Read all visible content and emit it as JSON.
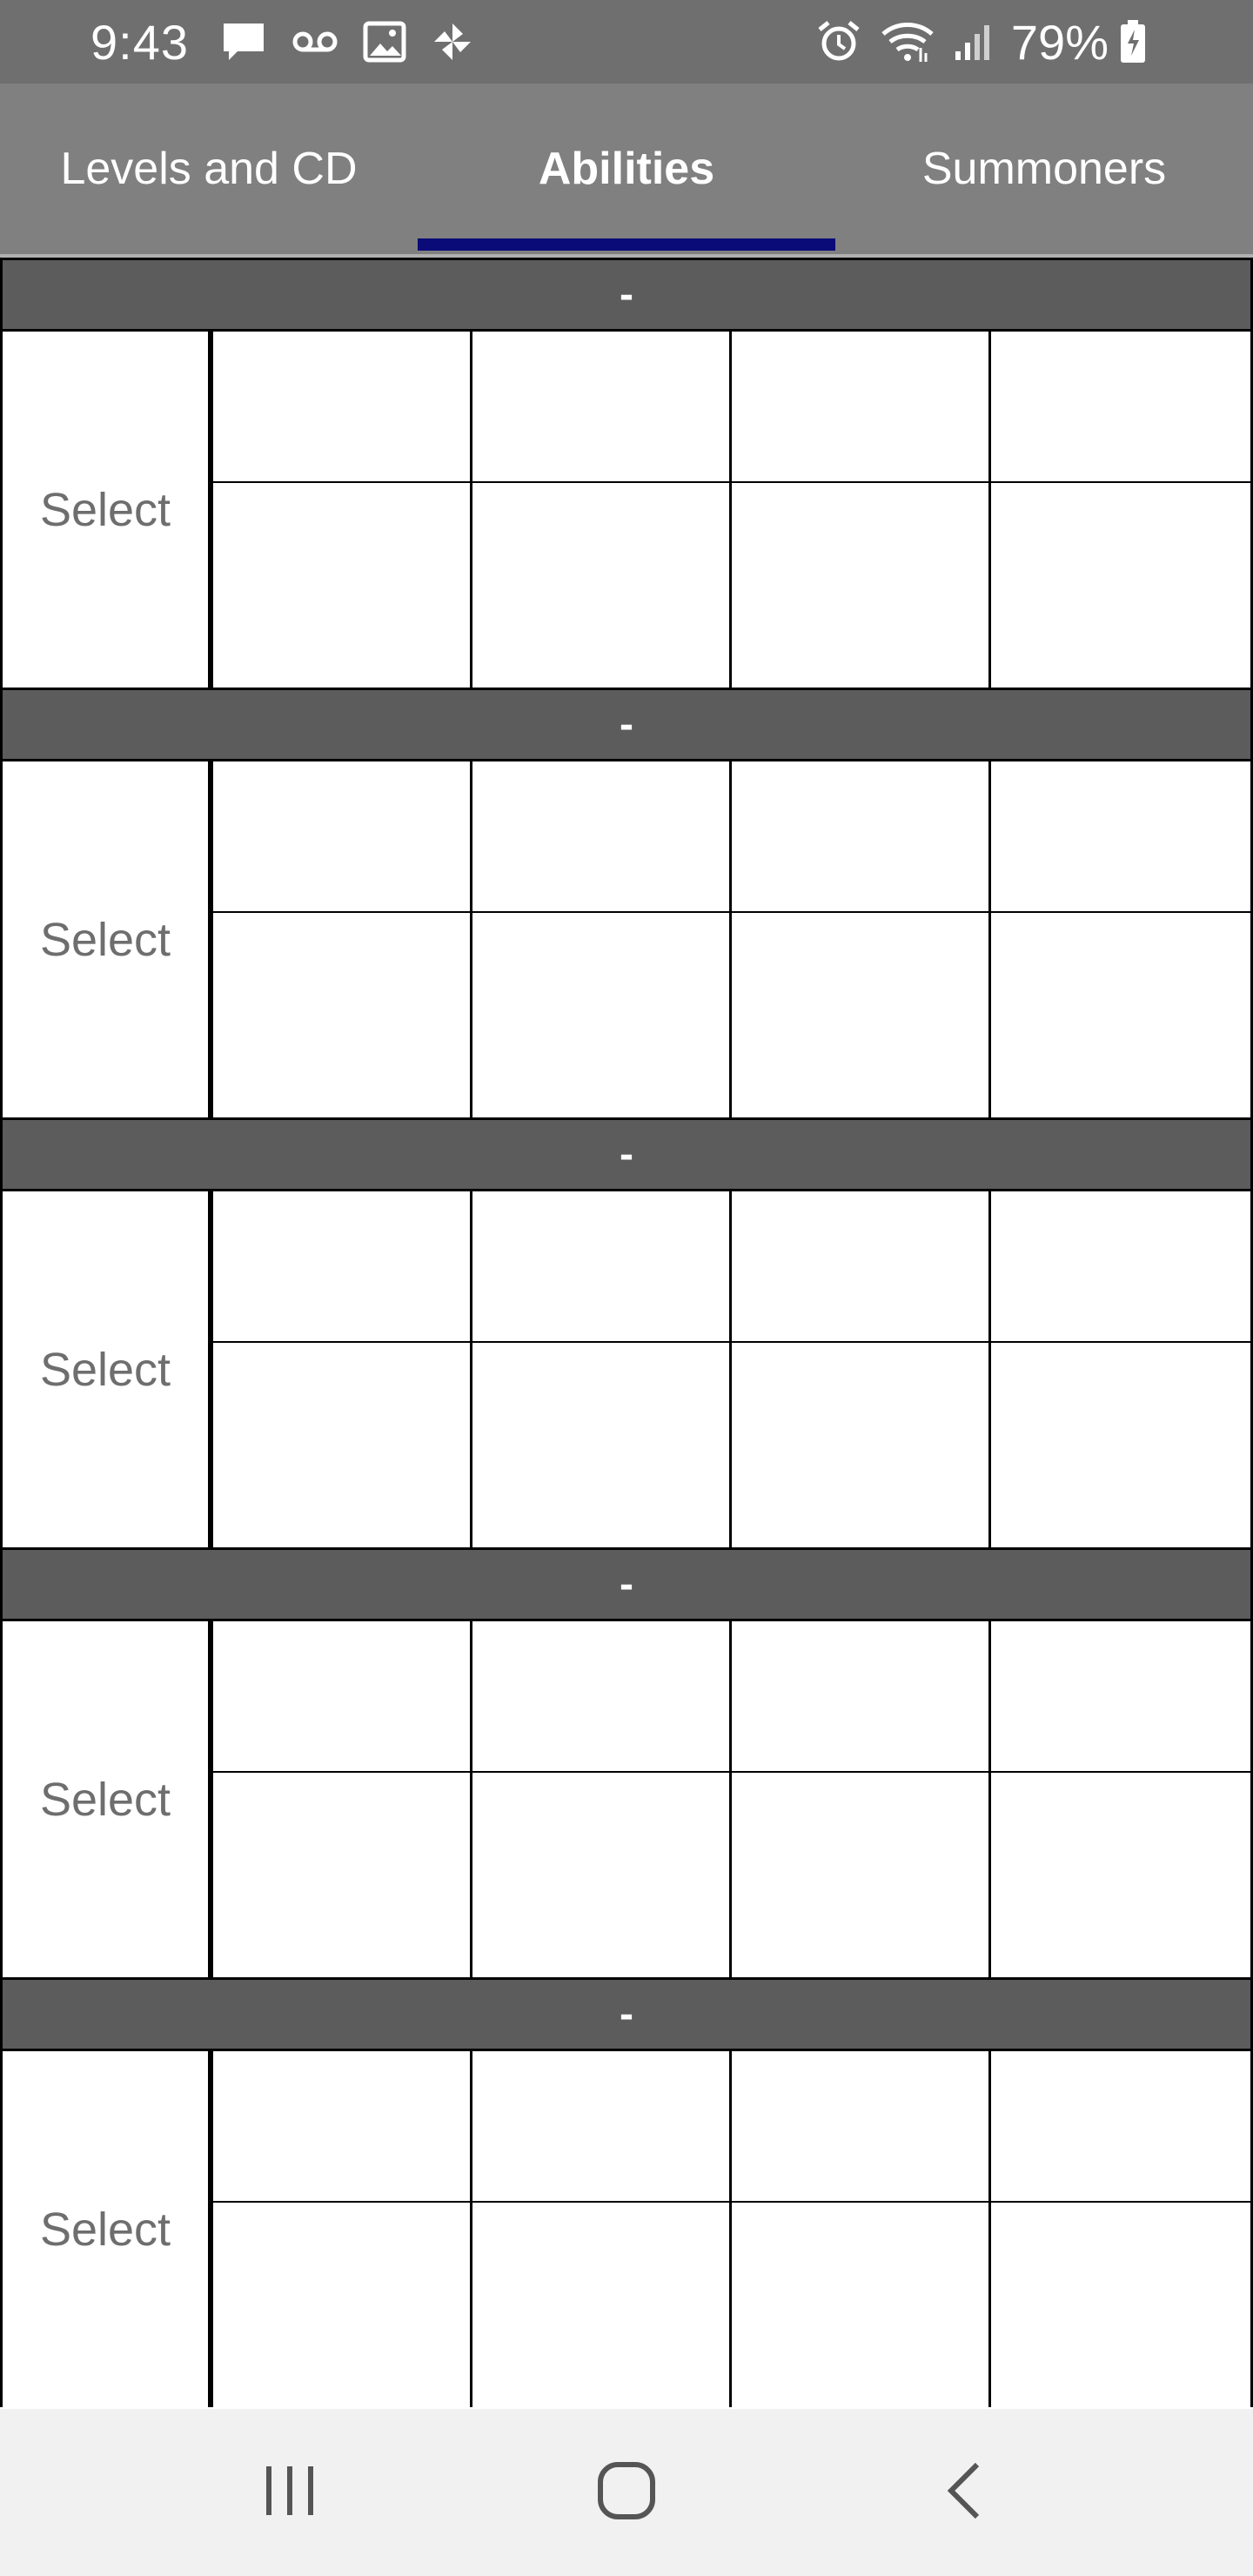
{
  "status_bar": {
    "time": "9:43",
    "battery": "79%",
    "left_icons": [
      "message-icon",
      "voicemail-icon",
      "image-icon",
      "pinwheel-icon"
    ],
    "right_icons": [
      "alarm-icon",
      "wifi-icon",
      "signal-icon",
      "battery-charging-icon"
    ]
  },
  "tabs": [
    {
      "label": "Levels and CD",
      "active": false
    },
    {
      "label": "Abilities",
      "active": true
    },
    {
      "label": "Summoners",
      "active": false
    }
  ],
  "sections": [
    {
      "header": "-",
      "select_label": "Select"
    },
    {
      "header": "-",
      "select_label": "Select"
    },
    {
      "header": "-",
      "select_label": "Select"
    },
    {
      "header": "-",
      "select_label": "Select"
    },
    {
      "header": "-",
      "select_label": "Select"
    }
  ],
  "nav_bar": {
    "icons": [
      "recent-apps-icon",
      "home-icon",
      "back-icon"
    ]
  },
  "colors": {
    "status_bar": "#6f6f6f",
    "tab_bar": "#808080",
    "tab_indicator": "#0a0a78",
    "section_header": "#5c5c5c",
    "nav_bar": "#f1f1f1"
  }
}
